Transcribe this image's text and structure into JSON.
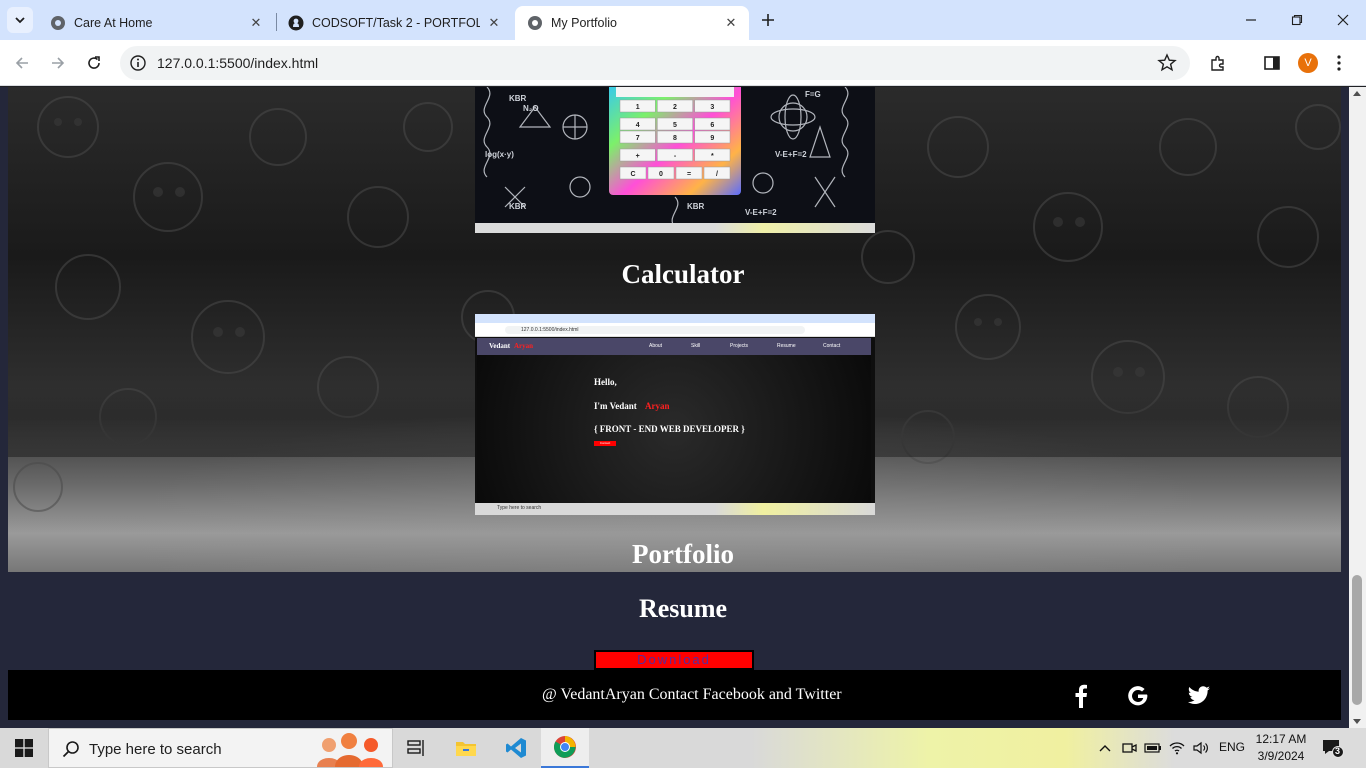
{
  "browser": {
    "tabs": [
      {
        "title": "Care At Home"
      },
      {
        "title": "CODSOFT/Task 2 - PORTFOLIO"
      },
      {
        "title": "My Portfolio"
      }
    ],
    "address": "127.0.0.1:5500/index.html",
    "profile_initial": "V",
    "accent": "#d3e3fd"
  },
  "page": {
    "calc_shot": {
      "keys": [
        [
          "1",
          "2",
          "3"
        ],
        [
          "4",
          "5",
          "6"
        ],
        [
          "7",
          "8",
          "9"
        ],
        [
          "+",
          "-",
          "*"
        ],
        [
          "C",
          "0",
          "=",
          "/"
        ]
      ]
    },
    "calculator_heading": "Calculator",
    "portfolio_shot": {
      "brand_first": "Vedant",
      "brand_second": "Aryan",
      "nav": [
        "About",
        "Skill",
        "Projects",
        "Resume",
        "Contact"
      ],
      "hello": "Hello,",
      "intro_prefix": "I'm Vedant ",
      "intro_name": "Aryan",
      "role": "{ FRONT - END WEB DEVELOPER }",
      "button": "Contact",
      "url": "127.0.0.1:5500/index.html",
      "taskbar_search": "Type here to search"
    },
    "portfolio_heading": "Portfolio",
    "resume_heading": "Resume",
    "download_label": "Download",
    "footer_text": "@ VedantAryan Contact Facebook and Twitter",
    "social": [
      "facebook-icon",
      "google-icon",
      "twitter-icon"
    ],
    "colors": {
      "download_bg": "#ff0000",
      "footer_bg": "#000000",
      "section_bg": "#24273a"
    }
  },
  "taskbar": {
    "search_placeholder": "Type here to search",
    "language": "ENG",
    "time": "12:17 AM",
    "date": "3/9/2024",
    "notifications": "3"
  }
}
